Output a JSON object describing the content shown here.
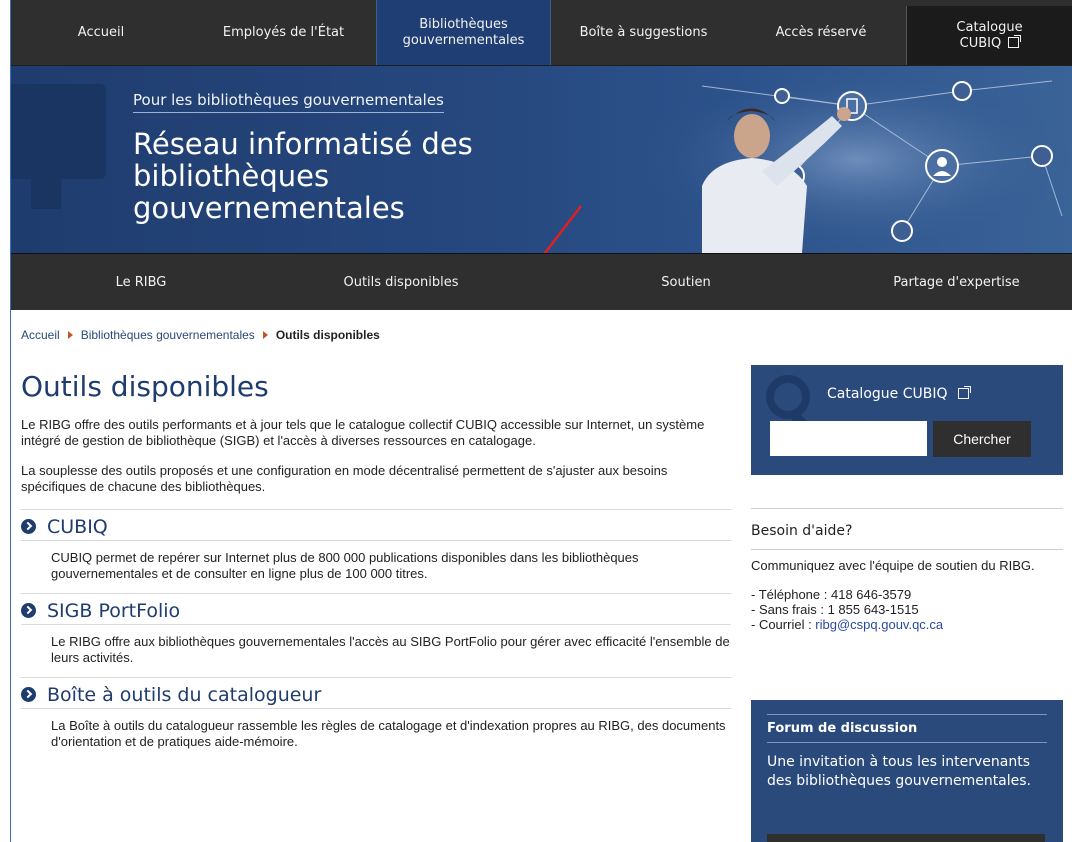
{
  "topnav": {
    "items": [
      {
        "label": "Accueil"
      },
      {
        "label": "Employés de l'État"
      },
      {
        "label": "Bibliothèques gouvernementales",
        "active": true
      },
      {
        "label": "Boîte à suggestions"
      },
      {
        "label": "Accès réservé"
      },
      {
        "label": "Catalogue CUBIQ",
        "icon": "external-link-icon"
      }
    ]
  },
  "banner": {
    "kicker": "Pour les bibliothèques gouvernementales",
    "title": "Réseau informatisé des bibliothèques gouvernementales"
  },
  "subnav": {
    "items": [
      {
        "label": "Le RIBG"
      },
      {
        "label": "Outils disponibles"
      },
      {
        "label": "Soutien"
      },
      {
        "label": "Partage d'expertise"
      }
    ]
  },
  "breadcrumb": {
    "items": [
      "Accueil",
      "Bibliothèques gouvernementales",
      "Outils disponibles"
    ]
  },
  "main": {
    "title": "Outils disponibles",
    "intro1": "Le RIBG offre des outils performants et à jour tels que le catalogue collectif CUBIQ accessible sur Internet, un système intégré de gestion de bibliothèque (SIGB) et l'accès à diverses ressources en catalogage.",
    "intro2": "La souplesse des outils proposés et une configuration en mode décentralisé permettent de s'ajuster aux besoins spécifiques de chacune des bibliothèques.",
    "sections": [
      {
        "title": "CUBIQ",
        "text": "CUBIQ permet de repérer sur Internet plus de 800 000 publications disponibles dans les bibliothèques gouvernementales et de consulter en ligne plus de 100 000 titres."
      },
      {
        "title": "SIGB PortFolio",
        "text": "Le RIBG offre aux bibliothèques gouvernementales l'accès au SIBG PortFolio pour gérer avec efficacité l'ensemble de leurs activités."
      },
      {
        "title": "Boîte à outils du catalogueur",
        "text": "La Boîte à outils du catalogueur rassemble les règles de catalogage et d'indexation propres au RIBG, des documents d'orientation et de pratiques aide-mémoire."
      }
    ]
  },
  "sidebar": {
    "search": {
      "label": "Catalogue CUBIQ",
      "button": "Chercher",
      "value": ""
    },
    "help": {
      "title": "Besoin d'aide?",
      "text": "Communiquez avec l'équipe de soutien du RIBG.",
      "phone": "- Téléphone : 418 646-3579",
      "tollfree": "- Sans frais : 1 855 643-1515",
      "email_prefix": "- Courriel : ",
      "email": "ribg@cspq.gouv.qc.ca"
    },
    "forum": {
      "title": "Forum de discussion",
      "text": "Une invitation à tous les intervenants des bibliothèques gouvernementales."
    }
  },
  "colors": {
    "nav_bg": "#2f2f2f",
    "brand_blue": "#1f3c6e",
    "panel_blue": "#2a4a7c",
    "arrow_red": "#e02020"
  }
}
